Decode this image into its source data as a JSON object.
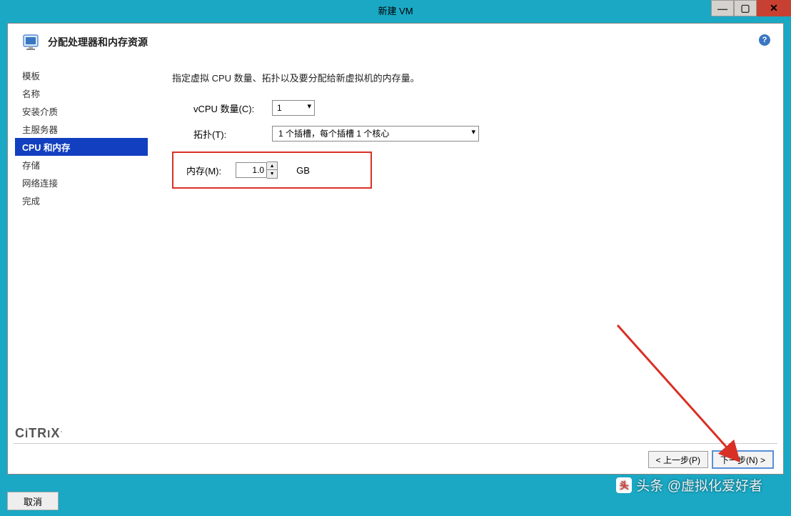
{
  "window": {
    "title": "新建 VM"
  },
  "header": {
    "title": "分配处理器和内存资源"
  },
  "sidebar": {
    "items": [
      {
        "label": "模板"
      },
      {
        "label": "名称"
      },
      {
        "label": "安装介质"
      },
      {
        "label": "主服务器"
      },
      {
        "label": "CPU 和内存"
      },
      {
        "label": "存储"
      },
      {
        "label": "网络连接"
      },
      {
        "label": "完成"
      }
    ]
  },
  "content": {
    "description": "指定虚拟 CPU 数量、拓扑以及要分配给新虚拟机的内存量。",
    "vcpu_label": "vCPU 数量(C):",
    "vcpu_value": "1",
    "topology_label": "拓扑(T):",
    "topology_value": "1 个插槽，每个插槽 1 个核心",
    "memory_label": "内存(M):",
    "memory_value": "1.0",
    "memory_unit": "GB"
  },
  "footer": {
    "prev": "< 上一步(P)",
    "next": "下一步(N) >",
    "cancel": "取消"
  },
  "brand": "CİTRIX",
  "watermark": "头条 @虚拟化爱好者"
}
